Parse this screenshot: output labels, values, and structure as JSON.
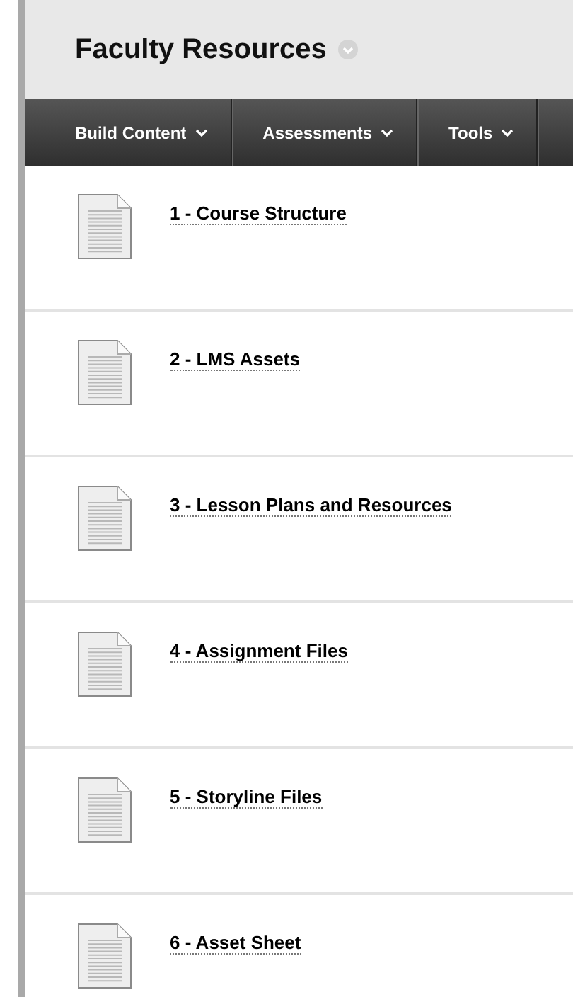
{
  "page_title": "Faculty Resources",
  "menu": [
    {
      "label": "Build Content"
    },
    {
      "label": "Assessments"
    },
    {
      "label": "Tools"
    }
  ],
  "items": [
    {
      "title": "1 - Course Structure"
    },
    {
      "title": "2 - LMS Assets"
    },
    {
      "title": "3 - Lesson Plans and Resources"
    },
    {
      "title": "4 - Assignment Files"
    },
    {
      "title": "5 - Storyline Files"
    },
    {
      "title": "6 - Asset Sheet"
    }
  ]
}
